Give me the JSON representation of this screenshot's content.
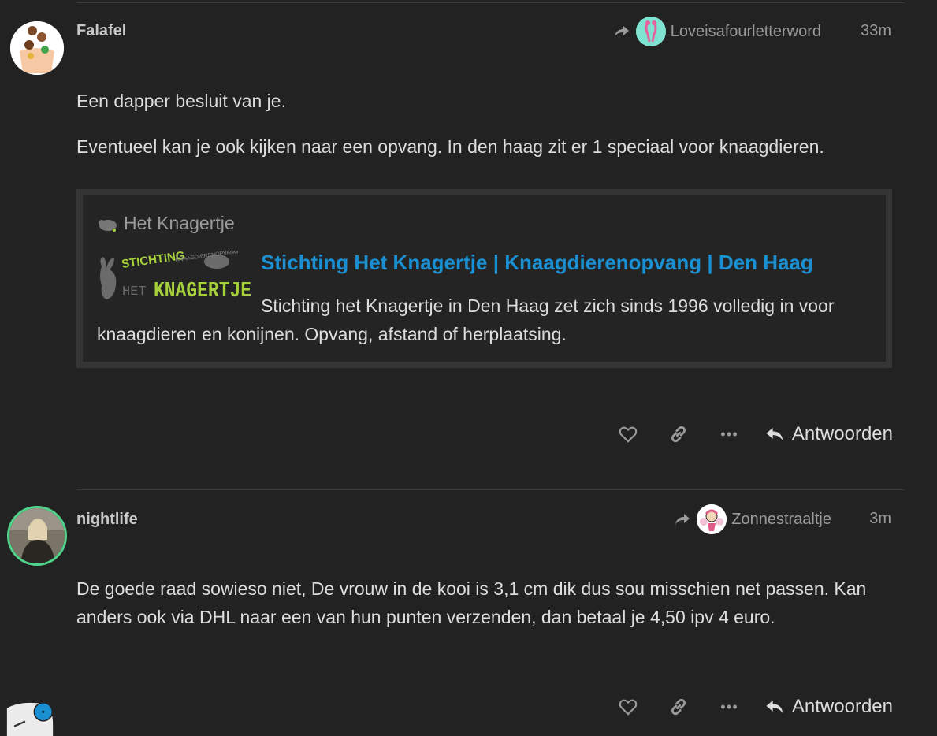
{
  "posts": [
    {
      "username": "Falafel",
      "reply_to": "Loveisafourletterword",
      "date": "33m",
      "paragraphs": [
        "Een dapper besluit van je.",
        "Eventueel kan je ook kijken naar een opvang. In den haag zit er 1 speciaal voor knaagdieren."
      ],
      "onebox": {
        "source": "Het Knagertje",
        "thumb_text_top": "STICHTING",
        "thumb_text_small": "KNAAGDIERENOPVANG",
        "thumb_text_het": "HET",
        "thumb_text_main": "KNAGERTJE",
        "title": "Stichting Het Knagertje | Knaagdierenopvang | Den Haag",
        "description": "Stichting het Knagertje in Den Haag zet zich sinds 1996 volledig in voor knaagdieren en konijnen. Opvang, afstand of herplaatsing."
      },
      "reply_label": "Antwoorden"
    },
    {
      "username": "nightlife",
      "reply_to": "Zonnestraaltje",
      "date": "3m",
      "paragraphs": [
        "De goede raad sowieso niet, De vrouw in de kooi is 3,1 cm dik dus sou misschien net passen. Kan anders ook via DHL naar een van hun punten verzenden, dan betaal je 4,50 ipv 4 euro."
      ],
      "reply_label": "Antwoorden"
    }
  ],
  "colors": {
    "background": "#222222",
    "link": "#1a8fd1",
    "muted": "#9a9a9a",
    "avatar_ring": "#4fd38a",
    "notification_dot": "#1a8fd1"
  },
  "icons": [
    "share-arrow-icon",
    "heart-icon",
    "link-icon",
    "more-icon",
    "reply-icon",
    "mouse-icon"
  ]
}
